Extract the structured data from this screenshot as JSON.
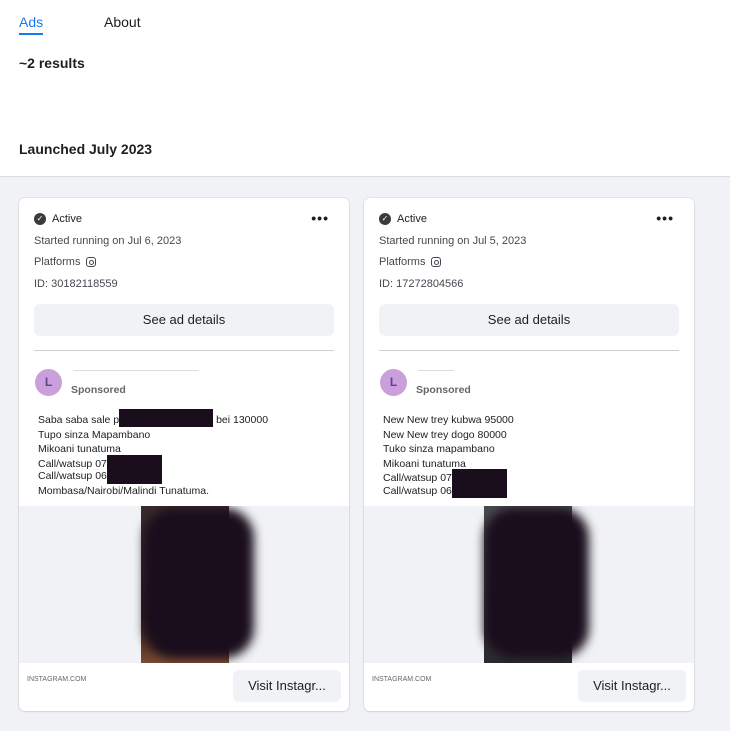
{
  "tabs": [
    {
      "label": "Ads",
      "active": true
    },
    {
      "label": "About",
      "active": false
    }
  ],
  "results_count": "~2 results",
  "group_heading": "Launched July 2023",
  "accent_color": "#1877f2",
  "cards": [
    {
      "status": "Active",
      "started": "Started running on Jul 6, 2023",
      "platforms_label": "Platforms",
      "platform_icon": "instagram-icon",
      "id": "ID: 30182118559",
      "see_details": "See ad details",
      "avatar_letter": "L",
      "sponsored": "Sponsored",
      "body_lines": [
        {
          "pre": "Saba saba sale p",
          "post": " bei 130000"
        },
        {
          "pre": "Tupo sinza Mapambano",
          "post": ""
        },
        {
          "pre": "Mikoani tunatuma",
          "post": ""
        },
        {
          "pre": "Call/watsup 07",
          "post": ""
        },
        {
          "pre": "Call/watsup 06",
          "post": ""
        },
        {
          "pre": "Mombasa/Nairobi/Malindi Tunatuma.",
          "post": ""
        }
      ],
      "domain": "INSTAGRAM.COM",
      "cta": "Visit Instagr..."
    },
    {
      "status": "Active",
      "started": "Started running on Jul 5, 2023",
      "platforms_label": "Platforms",
      "platform_icon": "instagram-icon",
      "id": "ID: 17272804566",
      "see_details": "See ad details",
      "avatar_letter": "L",
      "sponsored": "Sponsored",
      "body_lines": [
        {
          "pre": "New New trey kubwa 95000",
          "post": ""
        },
        {
          "pre": "New New trey dogo 80000",
          "post": ""
        },
        {
          "pre": "Tuko sinza mapambano",
          "post": ""
        },
        {
          "pre": "Mikoani tunatuma",
          "post": ""
        },
        {
          "pre": "Call/watsup 07",
          "post": ""
        },
        {
          "pre": "Call/watsup 06",
          "post": ""
        }
      ],
      "domain": "INSTAGRAM.COM",
      "cta": "Visit Instagr..."
    }
  ]
}
